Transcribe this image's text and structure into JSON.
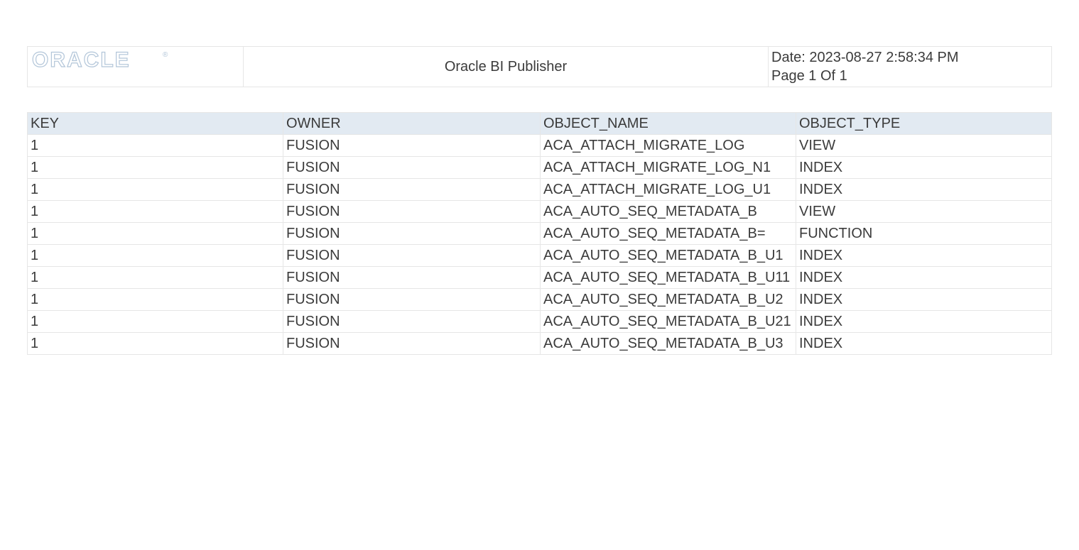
{
  "header": {
    "logo_text": "ORACLE",
    "title": "Oracle BI Publisher",
    "date_line": "Date: 2023-08-27 2:58:34 PM",
    "page_line": "Page 1 Of 1"
  },
  "table": {
    "columns": {
      "key": "KEY",
      "owner": "OWNER",
      "object_name": "OBJECT_NAME",
      "object_type": "OBJECT_TYPE"
    },
    "rows": [
      {
        "key": "1",
        "owner": "FUSION",
        "object_name": "ACA_ATTACH_MIGRATE_LOG",
        "object_type": "VIEW"
      },
      {
        "key": "1",
        "owner": "FUSION",
        "object_name": "ACA_ATTACH_MIGRATE_LOG_N1",
        "object_type": "INDEX"
      },
      {
        "key": "1",
        "owner": "FUSION",
        "object_name": "ACA_ATTACH_MIGRATE_LOG_U1",
        "object_type": "INDEX"
      },
      {
        "key": "1",
        "owner": "FUSION",
        "object_name": "ACA_AUTO_SEQ_METADATA_B",
        "object_type": "VIEW"
      },
      {
        "key": "1",
        "owner": "FUSION",
        "object_name": "ACA_AUTO_SEQ_METADATA_B=",
        "object_type": "FUNCTION"
      },
      {
        "key": "1",
        "owner": "FUSION",
        "object_name": "ACA_AUTO_SEQ_METADATA_B_U1",
        "object_type": "INDEX"
      },
      {
        "key": "1",
        "owner": "FUSION",
        "object_name": "ACA_AUTO_SEQ_METADATA_B_U11",
        "object_type": "INDEX"
      },
      {
        "key": "1",
        "owner": "FUSION",
        "object_name": "ACA_AUTO_SEQ_METADATA_B_U2",
        "object_type": "INDEX"
      },
      {
        "key": "1",
        "owner": "FUSION",
        "object_name": "ACA_AUTO_SEQ_METADATA_B_U21",
        "object_type": "INDEX"
      },
      {
        "key": "1",
        "owner": "FUSION",
        "object_name": "ACA_AUTO_SEQ_METADATA_B_U3",
        "object_type": "INDEX"
      }
    ]
  }
}
